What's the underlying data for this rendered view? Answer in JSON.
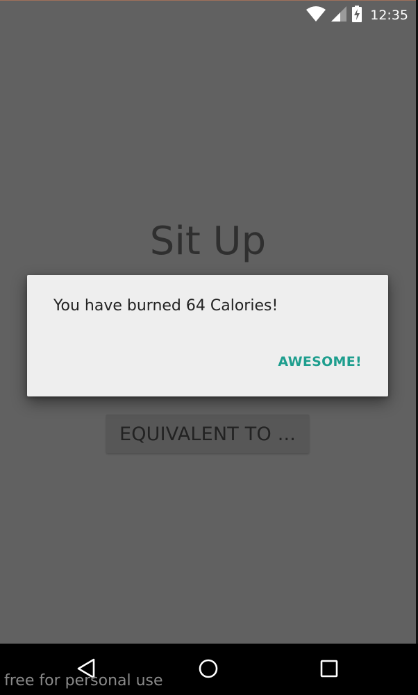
{
  "status_bar": {
    "time": "12:35",
    "icons": [
      "wifi-icon",
      "signal-icon",
      "battery-charging-icon"
    ]
  },
  "screen": {
    "title": "Sit Up",
    "equivalent_button_label": "EQUIVALENT TO ..."
  },
  "dialog": {
    "message": "You have burned 64 Calories!",
    "action_label": "AWESOME!"
  },
  "nav_bar": {
    "icons": [
      "back-icon",
      "home-icon",
      "recents-icon"
    ]
  },
  "watermark": {
    "text": "free for personal use"
  },
  "colors": {
    "background": "#616161",
    "dialog_background": "#eeeeee",
    "accent": "#1e9e8e",
    "nav_bar": "#000000"
  }
}
